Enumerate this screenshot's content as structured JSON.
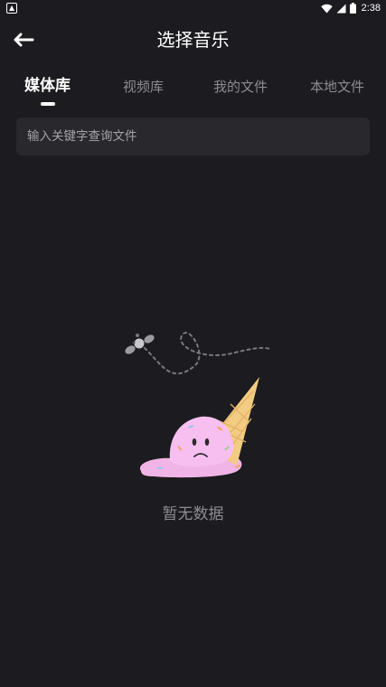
{
  "status_bar": {
    "time": "2:38",
    "icons": [
      "notification-icon",
      "wifi-icon",
      "signal-icon",
      "battery-icon"
    ]
  },
  "header": {
    "title": "选择音乐",
    "back_icon": "back-arrow-icon"
  },
  "tabs": [
    {
      "label": "媒体库",
      "active": true
    },
    {
      "label": "视频库",
      "active": false
    },
    {
      "label": "我的文件",
      "active": false
    },
    {
      "label": "本地文件",
      "active": false
    }
  ],
  "search": {
    "placeholder": "输入关键字查询文件",
    "value": ""
  },
  "empty_state": {
    "message": "暂无数据",
    "illustration": "melted-ice-cream-illustration"
  },
  "colors": {
    "background": "#1c1b1f",
    "search_background": "#29282d",
    "muted_text": "#8d8c91",
    "active_text": "#ffffff"
  }
}
